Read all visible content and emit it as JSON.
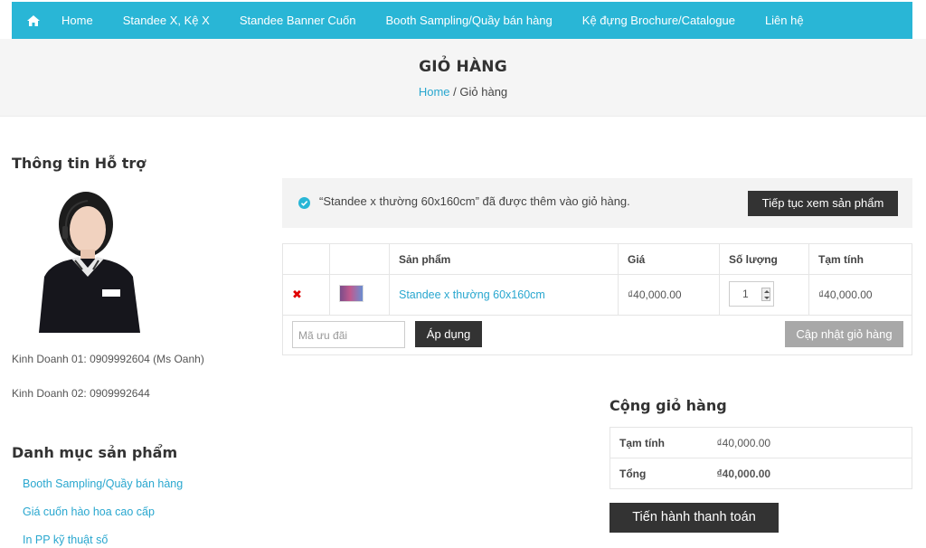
{
  "nav": {
    "items": [
      "Home",
      "Standee X, Kệ X",
      "Standee Banner Cuốn",
      "Booth Sampling/Quầy bán hàng",
      "Kệ đựng Brochure/Catalogue",
      "Liên hệ"
    ]
  },
  "hero": {
    "title": "GIỎ HÀNG",
    "breadcrumb_home": "Home",
    "breadcrumb_sep": "/",
    "breadcrumb_current": "Giỏ hàng"
  },
  "sidebar": {
    "support_title": "Thông tin Hỗ trợ",
    "sales1": "Kinh Doanh 01: 0909992604 (Ms Oanh)",
    "sales2": "Kinh Doanh 02: 0909992644",
    "category_title": "Danh mục sản phẩm",
    "categories": [
      "Booth Sampling/Quầy bán hàng",
      "Giá cuốn hào hoa cao cấp",
      "In PP kỹ thuật số"
    ]
  },
  "notice": {
    "message": "“Standee x thường 60x160cm” đã được thêm vào giỏ hàng.",
    "continue_label": "Tiếp tục xem sản phẩm"
  },
  "cart": {
    "headers": [
      "Sản phẩm",
      "Giá",
      "Số lượng",
      "Tạm tính"
    ],
    "rows": [
      {
        "name": "Standee x thường 60x160cm",
        "price": "₫40,000.00",
        "qty": "1",
        "subtotal": "₫40,000.00"
      }
    ],
    "coupon_placeholder": "Mã ưu đãi",
    "apply_label": "Áp dụng",
    "update_label": "Cập nhật giỏ hàng"
  },
  "totals": {
    "title": "Cộng giỏ hàng",
    "subtotal_label": "Tạm tính",
    "subtotal_value": "₫40,000.00",
    "total_label": "Tổng",
    "total_value": "₫40,000.00",
    "checkout_label": "Tiến hành thanh toán"
  },
  "colors": {
    "accent": "#29b6d6",
    "dark_button": "#333333",
    "remove": "#e00000"
  }
}
